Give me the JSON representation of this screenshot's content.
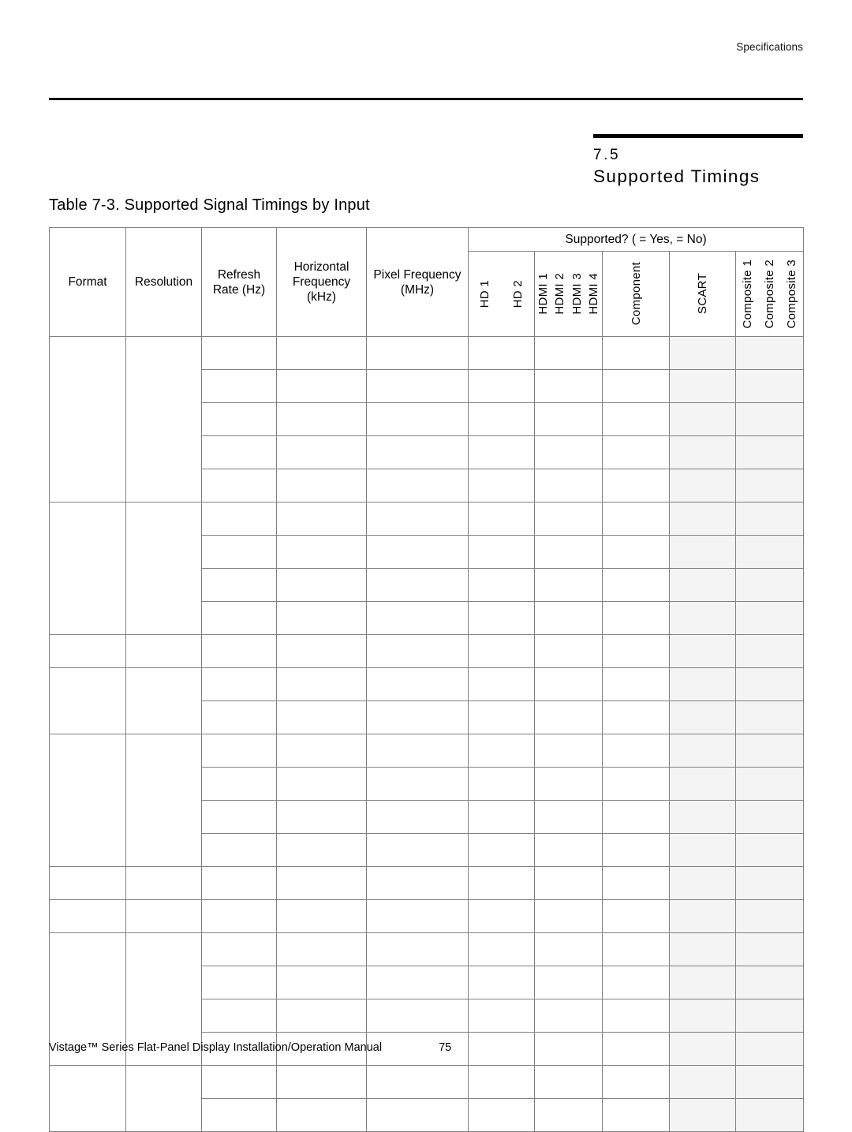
{
  "page": {
    "running_head": "Specifications",
    "section_number": "7.5",
    "section_title": "Supported Timings",
    "table_caption": "Table 7-3. Supported Signal Timings by Input"
  },
  "table": {
    "headers": {
      "format": "Format",
      "resolution": "Resolution",
      "refresh_rate": "Refresh\nRate (Hz)",
      "refresh_rate_l1": "Refresh",
      "refresh_rate_l2": "Rate (Hz)",
      "horizontal_frequency_l1": "Horizontal",
      "horizontal_frequency_l2": "Frequency",
      "horizontal_frequency_l3": "(kHz)",
      "pixel_frequency_l1": "Pixel Frequency",
      "pixel_frequency_l2": "(MHz)",
      "supported_span": "Supported? (  = Yes,   = No)"
    },
    "input_columns": {
      "hd": [
        "HD 1",
        "HD 2"
      ],
      "hdmi": [
        "HDMI 1",
        "HDMI 2",
        "HDMI 3",
        "HDMI 4"
      ],
      "component": [
        "Component"
      ],
      "scart": [
        "SCART"
      ],
      "composite": [
        "Composite 1",
        "Composite 2",
        "Composite 3"
      ]
    },
    "shaded_columns": [
      "SCART",
      "Composite"
    ],
    "shaded_color": "#f4f4f4",
    "format_groups": [
      {
        "rows": 5
      },
      {
        "rows": 4
      },
      {
        "rows": 1
      },
      {
        "rows": 2
      },
      {
        "rows": 4
      },
      {
        "rows": 1
      },
      {
        "rows": 1
      },
      {
        "rows": 4
      },
      {
        "rows": 2
      }
    ],
    "faint_row_indices": [
      2,
      8,
      16,
      21
    ],
    "body_rows": [
      {
        "format": "",
        "resolution": "",
        "refresh": "",
        "hfreq": "",
        "pfreq": "",
        "hd1": "",
        "hd2": "",
        "hdmi1": "",
        "hdmi2": "",
        "hdmi3": "",
        "hdmi4": "",
        "component": "",
        "scart": "",
        "comp1": "",
        "comp2": "",
        "comp3": ""
      }
    ]
  },
  "footer": {
    "manual_title": "Vistage™ Series Flat-Panel Display Installation/Operation Manual",
    "page_number": "75"
  }
}
